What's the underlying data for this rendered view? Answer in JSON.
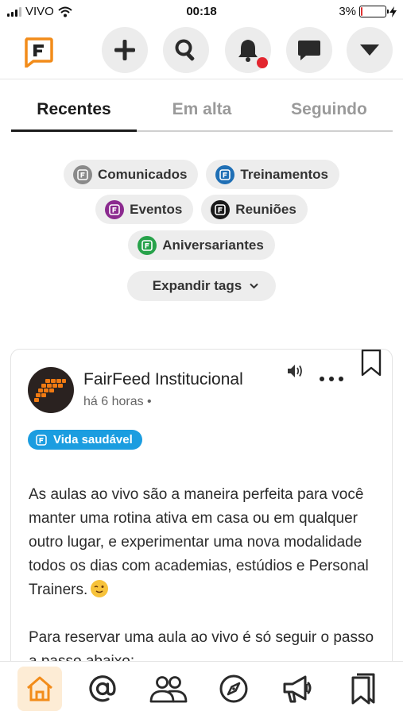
{
  "status_bar": {
    "carrier": "VIVO",
    "time": "00:18",
    "battery": "3%",
    "battery_level": 0.03
  },
  "header": {
    "logo_letter": "F",
    "buttons": {
      "add": "plus-icon",
      "search": "search-icon",
      "notifications": "bell-icon",
      "messages": "chat-icon",
      "menu": "chevron-down-icon"
    }
  },
  "tabs": [
    {
      "label": "Recentes",
      "active": true
    },
    {
      "label": "Em alta",
      "active": false
    },
    {
      "label": "Seguindo",
      "active": false
    }
  ],
  "tags": [
    {
      "label": "Comunicados",
      "color": "#8a8a8a"
    },
    {
      "label": "Treinamentos",
      "color": "#1f6fb5"
    },
    {
      "label": "Eventos",
      "color": "#8b2a8f"
    },
    {
      "label": "Reuniões",
      "color": "#1a1a1a"
    },
    {
      "label": "Aniversariantes",
      "color": "#27a24a"
    }
  ],
  "expand_tags": {
    "label": "Expandir tags"
  },
  "post": {
    "author": "FairFeed Institucional",
    "time": "há 6 horas •",
    "topic": "Vida saudável",
    "paragraph1": "As aulas ao vivo são a maneira perfeita para você manter uma rotina ativa em casa ou em qualquer outro lugar, e experimentar uma nova modalidade todos os dias com academias, estúdios e Personal Trainers.",
    "paragraph2": "Para reservar uma aula ao vivo é só seguir o passo a passo abaixo:"
  },
  "colors": {
    "brand_orange": "#f28c1a",
    "notification_red": "#e3262f",
    "topic_blue": "#1b9de0"
  },
  "bottom_nav": [
    "home-icon",
    "mention-icon",
    "people-icon",
    "compass-icon",
    "megaphone-icon",
    "bookmark-icon"
  ]
}
